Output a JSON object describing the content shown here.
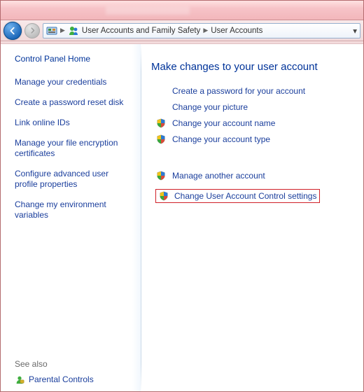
{
  "breadcrumb": {
    "level1": "User Accounts and Family Safety",
    "level2": "User Accounts"
  },
  "sidebar": {
    "home": "Control Panel Home",
    "links": [
      "Manage your credentials",
      "Create a password reset disk",
      "Link online IDs",
      "Manage your file encryption certificates",
      "Configure advanced user profile properties",
      "Change my environment variables"
    ],
    "seealso_title": "See also",
    "seealso_link": "Parental Controls"
  },
  "main": {
    "heading": "Make changes to your user account",
    "tasks_primary": [
      {
        "label": "Create a password for your account",
        "shield": false
      },
      {
        "label": "Change your picture",
        "shield": false
      },
      {
        "label": "Change your account name",
        "shield": true
      },
      {
        "label": "Change your account type",
        "shield": true
      }
    ],
    "tasks_secondary": [
      {
        "label": "Manage another account",
        "shield": true
      },
      {
        "label": "Change User Account Control settings",
        "shield": true,
        "highlighted": true
      }
    ]
  }
}
